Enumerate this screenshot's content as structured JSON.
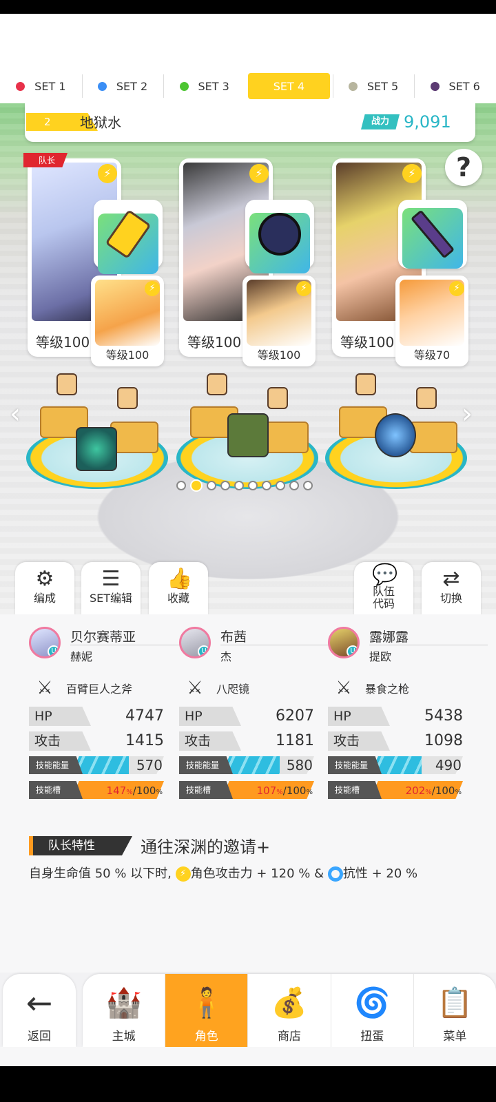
{
  "set_tabs": [
    {
      "label": "SET 1",
      "color": "#e8314a"
    },
    {
      "label": "SET 2",
      "color": "#3a8ef5"
    },
    {
      "label": "SET 3",
      "color": "#4cc531"
    },
    {
      "label": "SET 4",
      "color": "#ffd21f"
    },
    {
      "label": "SET 5",
      "color": "#b7b59e"
    },
    {
      "label": "SET 6",
      "color": "#5c3b73"
    }
  ],
  "team": {
    "number": "2",
    "name": "地狱水",
    "power_label": "战力",
    "power_value": "9,091"
  },
  "help": "?",
  "characters": [
    {
      "leader_tag": "队长",
      "level": "等级100",
      "pet_level": "等级100",
      "weapon_color": "#ffd21f"
    },
    {
      "level": "等级100",
      "pet_level": "等级100",
      "weapon_color": "#2a2f5c"
    },
    {
      "level": "等级100",
      "pet_level": "等级70",
      "weapon_color": "#5a3d8a"
    }
  ],
  "actions": {
    "formation": "编成",
    "set_edit": "SET编辑",
    "favorites": "收藏",
    "team_code_line1": "队伍",
    "team_code_line2": "代码",
    "switch": "切换"
  },
  "stats": [
    {
      "name": "贝尔赛蒂亚",
      "pet": "赫妮",
      "weapon": "百臂巨人之斧",
      "hp_label": "HP",
      "hp": "4747",
      "atk_label": "攻击",
      "atk": "1415",
      "energy_label": "技能能量",
      "energy": "570",
      "energy_fill": 0.62,
      "slot_label": "技能槽",
      "slot_pct": "147",
      "slot_max": "100",
      "slot_fill": 1.0
    },
    {
      "name": "布茜",
      "pet": "杰",
      "weapon": "八咫镜",
      "hp_label": "HP",
      "hp": "6207",
      "atk_label": "攻击",
      "atk": "1181",
      "energy_label": "技能能量",
      "energy": "580",
      "energy_fill": 0.63,
      "slot_label": "技能槽",
      "slot_pct": "107",
      "slot_max": "100",
      "slot_fill": 1.0
    },
    {
      "name": "露娜露",
      "pet": "提欧",
      "weapon": "暴食之枪",
      "hp_label": "HP",
      "hp": "5438",
      "atk_label": "攻击",
      "atk": "1098",
      "energy_label": "技能能量",
      "energy": "490",
      "energy_fill": 0.55,
      "slot_label": "技能槽",
      "slot_pct": "202",
      "slot_max": "100",
      "slot_fill": 1.0
    }
  ],
  "leader_skill": {
    "tag": "队长特性",
    "name": "通往深渊的邀请+",
    "desc_part1": "自身生命值 50 % 以下时,",
    "desc_part2": "角色攻击力 + 120 % &",
    "desc_part3": "抗性 + 20 %"
  },
  "page_dots": {
    "count": 10,
    "active": 1
  },
  "bottom_nav": {
    "back": "返回",
    "items": [
      "主城",
      "角色",
      "商店",
      "扭蛋",
      "菜单"
    ],
    "active": "角色"
  }
}
